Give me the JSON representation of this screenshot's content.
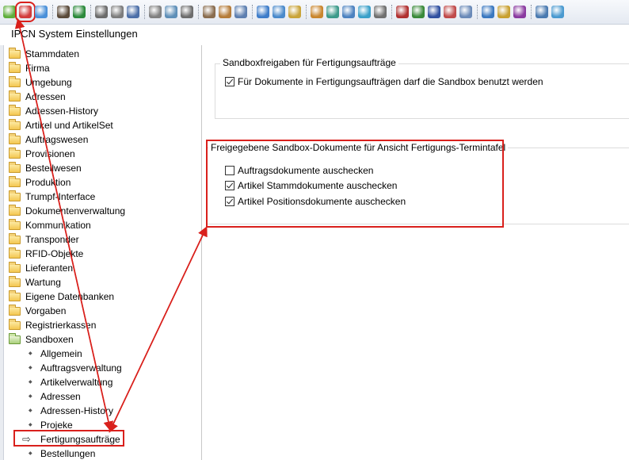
{
  "window": {
    "title": "IPCN System Einstellungen"
  },
  "colors": {
    "annotation_red": "#d9201c",
    "toolbar_bg": "#e4e9f1"
  },
  "toolbar": {
    "icons": [
      {
        "name": "settings-green-icon",
        "color": "#5fae3c"
      },
      {
        "name": "settings-red-icon",
        "color": "#d23b3b",
        "highlighted": true
      },
      {
        "name": "settings-blue-icon",
        "color": "#4a90d9"
      },
      {
        "name": "separator"
      },
      {
        "name": "user-icon",
        "color": "#5a4a3a"
      },
      {
        "name": "user-check-icon",
        "color": "#2c8a3c"
      },
      {
        "name": "separator"
      },
      {
        "name": "print-icon",
        "color": "#6b6b6b"
      },
      {
        "name": "printer-icon",
        "color": "#7d7d7d"
      },
      {
        "name": "document-icon",
        "color": "#4c6fa8"
      },
      {
        "name": "separator"
      },
      {
        "name": "clock-icon",
        "color": "#808080"
      },
      {
        "name": "globe-icon",
        "color": "#5e8fb8"
      },
      {
        "name": "disk-icon",
        "color": "#6d6d6d"
      },
      {
        "name": "separator"
      },
      {
        "name": "users-icon",
        "color": "#8a6d4f"
      },
      {
        "name": "tools-icon",
        "color": "#b57c3a"
      },
      {
        "name": "chart-icon",
        "color": "#5d7fb0"
      },
      {
        "name": "separator"
      },
      {
        "name": "gear-blue-icon",
        "color": "#3d7cc9"
      },
      {
        "name": "gears-icon",
        "color": "#4a8acb"
      },
      {
        "name": "box-icon",
        "color": "#c9a43a"
      },
      {
        "name": "separator"
      },
      {
        "name": "group-icon",
        "color": "#c9862e"
      },
      {
        "name": "exchange-icon",
        "color": "#3c9a8a"
      },
      {
        "name": "truck-icon",
        "color": "#4c82c0"
      },
      {
        "name": "star-icon",
        "color": "#3aa0c9"
      },
      {
        "name": "calculator-icon",
        "color": "#707070"
      },
      {
        "name": "separator"
      },
      {
        "name": "book-red-icon",
        "color": "#b03030"
      },
      {
        "name": "book-green-icon",
        "color": "#3a8a3a"
      },
      {
        "name": "book-blue-icon",
        "color": "#3050a0"
      },
      {
        "name": "stamp-icon",
        "color": "#c04a4a"
      },
      {
        "name": "image-icon",
        "color": "#6a8ab8"
      },
      {
        "name": "separator"
      },
      {
        "name": "pie-chart-icon",
        "color": "#3a78c0"
      },
      {
        "name": "folder-book-icon",
        "color": "#c8a030"
      },
      {
        "name": "book-purple-icon",
        "color": "#8a3aa0"
      },
      {
        "name": "separator"
      },
      {
        "name": "window-icon",
        "color": "#4a7ab0"
      },
      {
        "name": "chat-icon",
        "color": "#4a9ad0"
      }
    ]
  },
  "tree": {
    "folders": [
      "Stammdaten",
      "Firma",
      "Umgebung",
      "Adressen",
      "Adressen-History",
      "Artikel und ArtikelSet",
      "Auftragswesen",
      "Provisionen",
      "Bestellwesen",
      "Produktion",
      "Trumpf-Interface",
      "Dokumentenverwaltung",
      "Kommunikation",
      "Transponder",
      "RFID-Objekte",
      "Lieferanten",
      "Wartung",
      "Eigene Datenbanken",
      "Vorgaben",
      "Registrierkassen"
    ],
    "open_folder": "Sandboxen",
    "children": [
      "Allgemein",
      "Auftragsverwaltung",
      "Artikelverwaltung",
      "Adressen",
      "Adressen-History",
      "Projeke"
    ],
    "selected_child": "Fertigungsaufträge",
    "after_selected": [
      "Bestellungen"
    ]
  },
  "group1": {
    "title": "Sandboxfreigaben für Fertigungsaufträge",
    "checkboxes": [
      {
        "label": "Für Dokumente in Fertigungsaufträgen darf die Sandbox benutzt werden",
        "checked": true
      }
    ]
  },
  "group2": {
    "title": "Freigegebene Sandbox-Dokumente für Ansicht Fertigungs-Termintafel",
    "checkboxes": [
      {
        "label": "Auftragsdokumente auschecken",
        "checked": false
      },
      {
        "label": "Artikel Stammdokumente auschecken",
        "checked": true
      },
      {
        "label": "Artikel Positionsdokumente auschecken",
        "checked": true
      }
    ]
  }
}
